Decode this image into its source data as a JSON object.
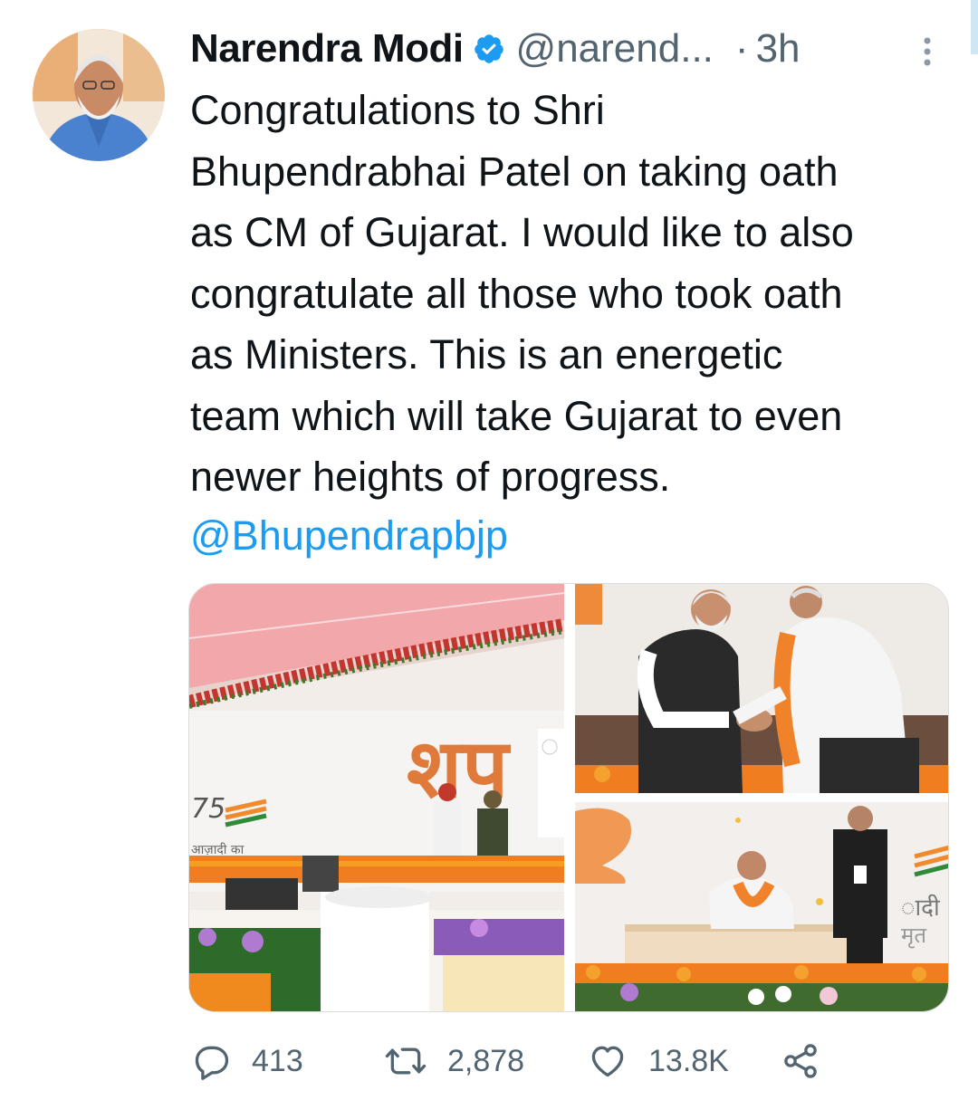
{
  "author": {
    "name": "Narendra Modi",
    "handle": "@narend...",
    "time": "3h",
    "separator": "·"
  },
  "tweet": {
    "text": "Congratulations to Shri\nBhupendrabhai Patel on taking oath\nas CM of Gujarat. I would like to also\ncongratulate all those who took oath\nas Ministers. This is an energetic\nteam which will take Gujarat to even\nnewer heights of progress.",
    "mention": "@Bhupendrapbjp"
  },
  "media": {
    "photo1": {
      "sign_text": "शप",
      "logo_text": "आज़ादी का",
      "logo_number": "75"
    },
    "photo2": {},
    "photo3": {
      "side_text_1": "ादी",
      "side_text_2": "मृत"
    }
  },
  "actions": {
    "replies": "413",
    "retweets": "2,878",
    "likes": "13.8K"
  },
  "colors": {
    "link": "#1d9bf0",
    "secondary": "#536471",
    "verified": "#1d9bf0"
  },
  "icons": [
    "verified-badge-icon",
    "more-options-icon",
    "reply-icon",
    "retweet-icon",
    "like-icon",
    "share-icon"
  ]
}
